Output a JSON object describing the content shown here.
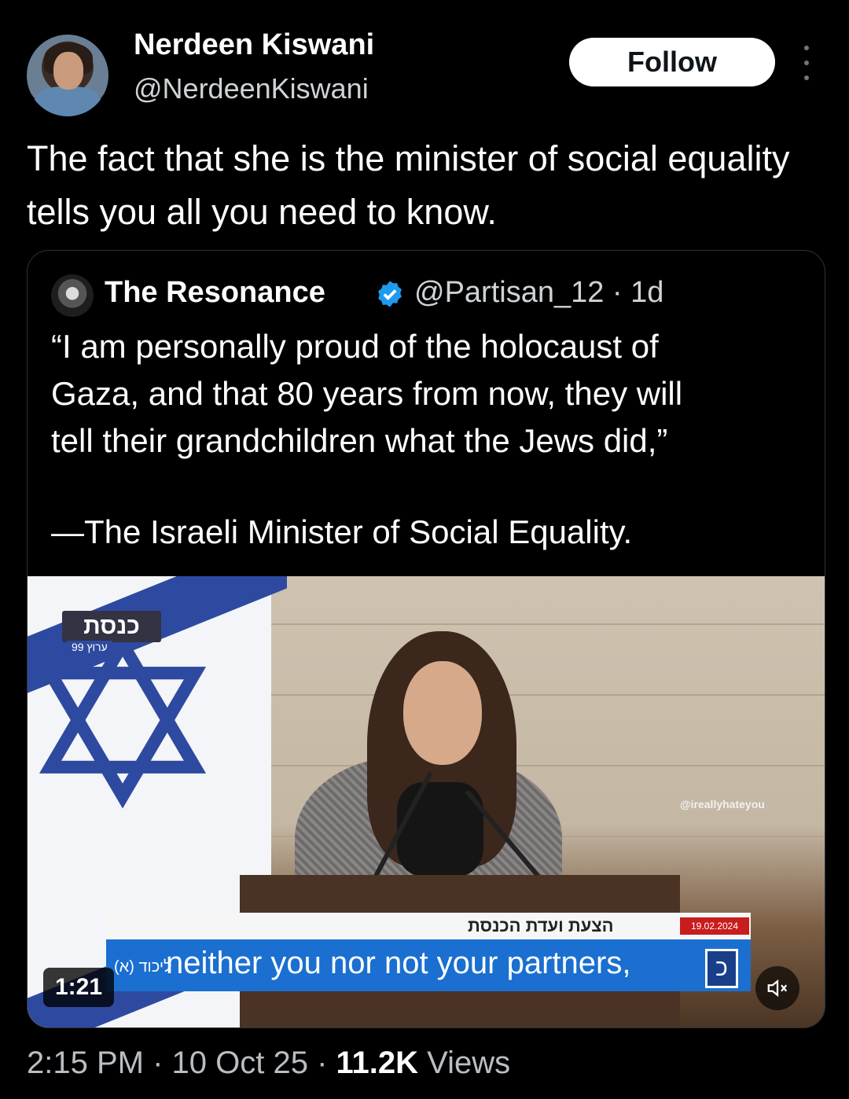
{
  "post": {
    "author_name": "Nerdeen Kiswani",
    "author_handle": "@NerdeenKiswani",
    "follow_label": "Follow",
    "text": "The fact that she is the minister of social equality tells you all you need to know."
  },
  "quote": {
    "name": "The Resonance",
    "meta": "@Partisan_12 · 1d",
    "text": "“I am personally proud of the holocaust of\nGaza, and that 80 years from now, they will\ntell their grandchildren what the Jews did,”",
    "attribution": "—The Israeli Minister of Social Equality.",
    "video": {
      "channel_logo": "כנסת",
      "channel_sub": "ערוץ 99",
      "watermark": "@ireallyhateyou",
      "ticker_label": "הצעת ועדת הכנסת",
      "ticker_date": "19.02.2024",
      "caption_hebrew": "(א) ליכוד",
      "caption": "neither you nor not your partners,",
      "caption_logo": "כ",
      "duration": "1:21"
    }
  },
  "footer": {
    "time_date": "2:15 PM · 10 Oct 25 · ",
    "views_count": "11.2K",
    "views_label": " Views"
  },
  "colors": {
    "verified": "#1d9bf0",
    "background": "#000000"
  },
  "icons": [
    "more-options-icon",
    "verified-badge-icon",
    "mute-icon"
  ]
}
